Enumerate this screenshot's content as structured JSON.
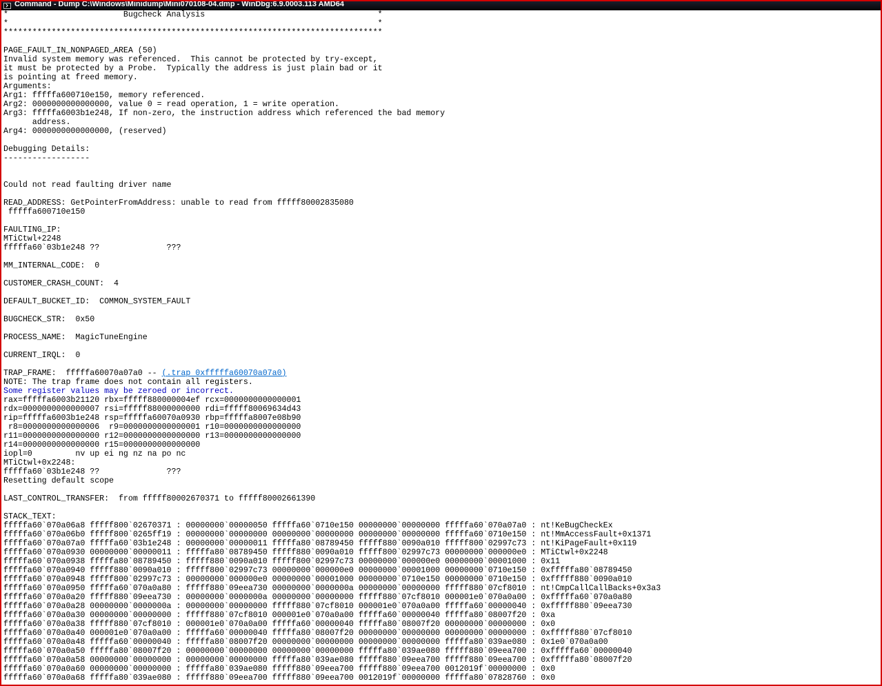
{
  "window": {
    "title": "Command - Dump C:\\Windows\\Minidump\\Mini070108-04.dmp - WinDbg:6.9.0003.113 AMD64"
  },
  "output": [
    {
      "text": "*                        Bugcheck Analysis                                    *"
    },
    {
      "text": "*                                                                             *"
    },
    {
      "text": "*******************************************************************************"
    },
    {
      "text": ""
    },
    {
      "text": "PAGE_FAULT_IN_NONPAGED_AREA (50)"
    },
    {
      "text": "Invalid system memory was referenced.  This cannot be protected by try-except,"
    },
    {
      "text": "it must be protected by a Probe.  Typically the address is just plain bad or it"
    },
    {
      "text": "is pointing at freed memory."
    },
    {
      "text": "Arguments:"
    },
    {
      "text": "Arg1: fffffa600710e150, memory referenced."
    },
    {
      "text": "Arg2: 0000000000000000, value 0 = read operation, 1 = write operation."
    },
    {
      "text": "Arg3: fffffa6003b1e248, If non-zero, the instruction address which referenced the bad memory"
    },
    {
      "text": "      address."
    },
    {
      "text": "Arg4: 0000000000000000, (reserved)"
    },
    {
      "text": ""
    },
    {
      "text": "Debugging Details:"
    },
    {
      "text": "------------------"
    },
    {
      "text": ""
    },
    {
      "text": ""
    },
    {
      "text": "Could not read faulting driver name"
    },
    {
      "text": ""
    },
    {
      "text": "READ_ADDRESS: GetPointerFromAddress: unable to read from fffff80002835080"
    },
    {
      "text": " fffffa600710e150"
    },
    {
      "text": ""
    },
    {
      "text": "FAULTING_IP:"
    },
    {
      "text": "MTiCtwl+2248"
    },
    {
      "text": "fffffa60`03b1e248 ??              ???"
    },
    {
      "text": ""
    },
    {
      "text": "MM_INTERNAL_CODE:  0"
    },
    {
      "text": ""
    },
    {
      "text": "CUSTOMER_CRASH_COUNT:  4"
    },
    {
      "text": ""
    },
    {
      "text": "DEFAULT_BUCKET_ID:  COMMON_SYSTEM_FAULT"
    },
    {
      "text": ""
    },
    {
      "text": "BUGCHECK_STR:  0x50"
    },
    {
      "text": ""
    },
    {
      "text": "PROCESS_NAME:  MagicTuneEngine"
    },
    {
      "text": ""
    },
    {
      "text": "CURRENT_IRQL:  0"
    },
    {
      "text": ""
    },
    {
      "text": "TRAP_FRAME:  fffffa60070a07a0 -- ",
      "link": "(.trap 0xfffffa60070a07a0)"
    },
    {
      "text": "NOTE: The trap frame does not contain all registers."
    },
    {
      "text": "Some register values may be zeroed or incorrect.",
      "style": "blue"
    },
    {
      "text": "rax=fffffa6003b21120 rbx=fffff880000004ef rcx=0000000000000001"
    },
    {
      "text": "rdx=0000000000000007 rsi=fffff88000000000 rdi=fffff80069634d43"
    },
    {
      "text": "rip=fffffa6003b1e248 rsp=fffffa60070a0930 rbp=fffffa8007e08b90"
    },
    {
      "text": " r8=0000000000000006  r9=0000000000000001 r10=0000000000000000"
    },
    {
      "text": "r11=0000000000000000 r12=0000000000000000 r13=0000000000000000"
    },
    {
      "text": "r14=0000000000000000 r15=0000000000000000"
    },
    {
      "text": "iopl=0         nv up ei ng nz na po nc"
    },
    {
      "text": "MTiCtwl+0x2248:"
    },
    {
      "text": "fffffa60`03b1e248 ??              ???"
    },
    {
      "text": "Resetting default scope"
    },
    {
      "text": ""
    },
    {
      "text": "LAST_CONTROL_TRANSFER:  from fffff80002670371 to fffff80002661390"
    },
    {
      "text": ""
    },
    {
      "text": "STACK_TEXT:"
    },
    {
      "text": "fffffa60`070a06a8 fffff800`02670371 : 00000000`00000050 fffffa60`0710e150 00000000`00000000 fffffa60`070a07a0 : nt!KeBugCheckEx"
    },
    {
      "text": "fffffa60`070a06b0 fffff800`0265ff19 : 00000000`00000000 00000000`00000000 00000000`00000000 fffffa60`0710e150 : nt!MmAccessFault+0x1371"
    },
    {
      "text": "fffffa60`070a07a0 fffffa60`03b1e248 : 00000000`00000011 fffffa80`08789450 fffff880`0090a010 fffff800`02997c73 : nt!KiPageFault+0x119"
    },
    {
      "text": "fffffa60`070a0930 00000000`00000011 : fffffa80`08789450 fffff880`0090a010 fffff800`02997c73 00000000`000000e0 : MTiCtwl+0x2248"
    },
    {
      "text": "fffffa60`070a0938 fffffa80`08789450 : fffff880`0090a010 fffff800`02997c73 00000000`000000e0 00000000`00001000 : 0x11"
    },
    {
      "text": "fffffa60`070a0940 fffff880`0090a010 : fffff800`02997c73 00000000`000000e0 00000000`00001000 00000000`0710e150 : 0xfffffa80`08789450"
    },
    {
      "text": "fffffa60`070a0948 fffff800`02997c73 : 00000000`000000e0 00000000`00001000 00000000`0710e150 00000000`0710e150 : 0xfffff880`0090a010"
    },
    {
      "text": "fffffa60`070a0950 fffffa60`070a0a80 : fffff880`09eea730 00000000`0000000a 00000000`00000000 fffff880`07cf8010 : nt!CmpCallCallBacks+0x3a3"
    },
    {
      "text": "fffffa60`070a0a20 fffff880`09eea730 : 00000000`0000000a 00000000`00000000 fffff880`07cf8010 000001e0`070a0a00 : 0xfffffa60`070a0a80"
    },
    {
      "text": "fffffa60`070a0a28 00000000`0000000a : 00000000`00000000 fffff880`07cf8010 000001e0`070a0a00 fffffa60`00000040 : 0xfffff880`09eea730"
    },
    {
      "text": "fffffa60`070a0a30 00000000`00000000 : fffff880`07cf8010 000001e0`070a0a00 fffffa60`00000040 fffffa80`08007f20 : 0xa"
    },
    {
      "text": "fffffa60`070a0a38 fffff880`07cf8010 : 000001e0`070a0a00 fffffa60`00000040 fffffa80`08007f20 00000000`00000000 : 0x0"
    },
    {
      "text": "fffffa60`070a0a40 000001e0`070a0a00 : fffffa60`00000040 fffffa80`08007f20 00000000`00000000 00000000`00000000 : 0xfffff880`07cf8010"
    },
    {
      "text": "fffffa60`070a0a48 fffffa60`00000040 : fffffa80`08007f20 00000000`00000000 00000000`00000000 fffffa80`039ae080 : 0x1e0`070a0a00"
    },
    {
      "text": "fffffa60`070a0a50 fffffa80`08007f20 : 00000000`00000000 00000000`00000000 fffffa80`039ae080 fffff880`09eea700 : 0xfffffa60`00000040"
    },
    {
      "text": "fffffa60`070a0a58 00000000`00000000 : 00000000`00000000 fffffa80`039ae080 fffff880`09eea700 fffff880`09eea700 : 0xfffffa80`08007f20"
    },
    {
      "text": "fffffa60`070a0a60 00000000`00000000 : fffffa80`039ae080 fffff880`09eea700 fffff880`09eea700 0012019f`00000000 : 0x0"
    },
    {
      "text": "fffffa60`070a0a68 fffffa80`039ae080 : fffff880`09eea700 fffff880`09eea700 0012019f`00000000 fffffa80`07828760 : 0x0"
    }
  ]
}
